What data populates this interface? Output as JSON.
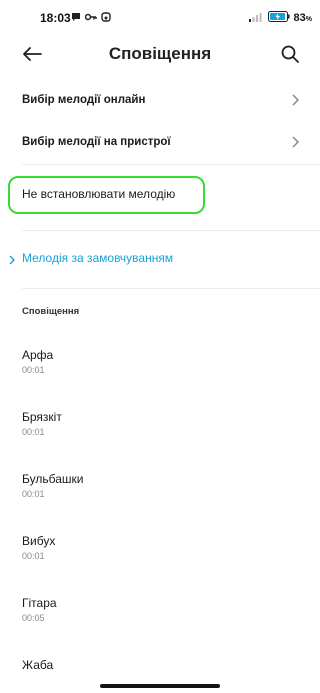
{
  "status_bar": {
    "time": "18:03",
    "battery_percent": "83",
    "battery_unit": "%",
    "icons_left": [
      "chat-icon",
      "key-icon",
      "app-icon"
    ],
    "icons_right": [
      "signal-icon",
      "battery-icon"
    ]
  },
  "header": {
    "title": "Сповіщення",
    "back_icon": "arrow-left-icon",
    "search_icon": "search-icon"
  },
  "options": [
    {
      "label": "Вибір мелодії онлайн"
    },
    {
      "label": "Вибір мелодії на пристрої"
    }
  ],
  "no_ringtone": {
    "label": "Не встановлювати мелодію"
  },
  "default_ringtone": {
    "label": "Мелодія за замовчуванням",
    "color": "#1ba1d4"
  },
  "section": {
    "title": "Сповіщення"
  },
  "sounds": [
    {
      "name": "Арфа",
      "duration": "00:01"
    },
    {
      "name": "Брязкіт",
      "duration": "00:01"
    },
    {
      "name": "Бульбашки",
      "duration": "00:01"
    },
    {
      "name": "Вибух",
      "duration": "00:01"
    },
    {
      "name": "Гітара",
      "duration": "00:05"
    },
    {
      "name": "Жаба",
      "duration": ""
    }
  ],
  "colors": {
    "highlight": "#33dd33",
    "accent": "#1ba1d4"
  }
}
